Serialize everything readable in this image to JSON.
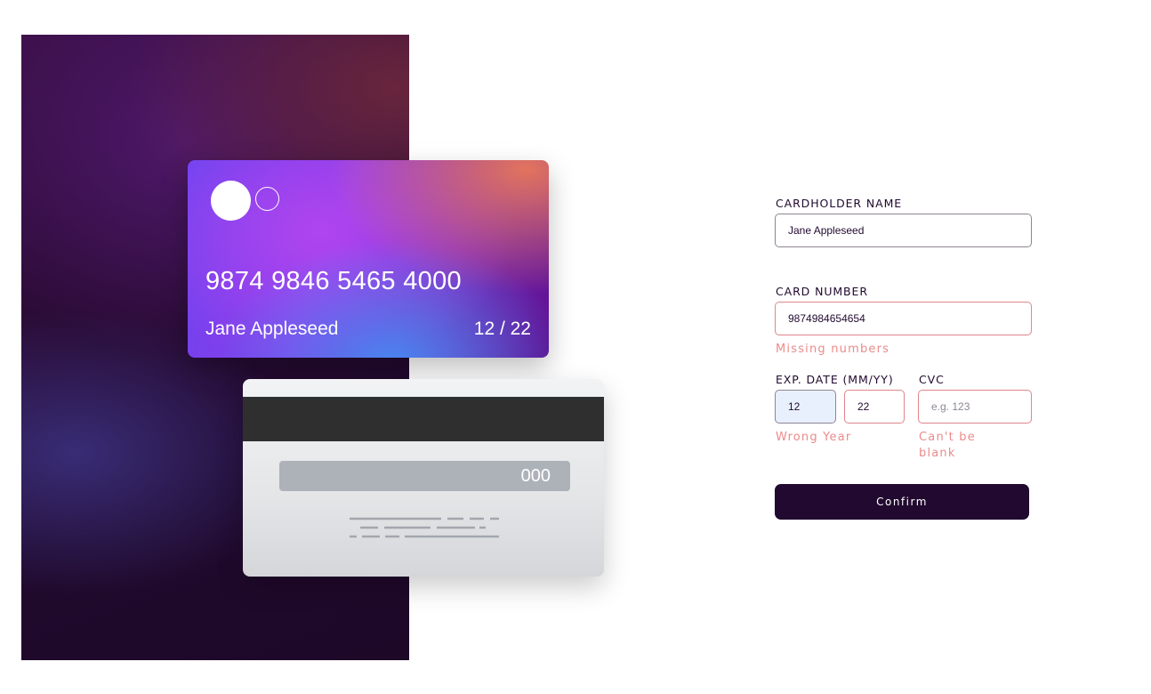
{
  "card_front": {
    "number": "9874 9846 5465 4000",
    "name": "Jane Appleseed",
    "expiry": "12 / 22"
  },
  "card_back": {
    "cvc": "000"
  },
  "form": {
    "cardholder_name": {
      "label": "CARDHOLDER NAME",
      "value": "Jane Appleseed"
    },
    "card_number": {
      "label": "CARD NUMBER",
      "value": "9874984654654",
      "error": "Missing numbers"
    },
    "exp_date": {
      "label": "EXP. DATE (MM/YY)",
      "month_value": "12",
      "year_value": "22",
      "error": "Wrong Year"
    },
    "cvc": {
      "label": "CVC",
      "placeholder": "e.g. 123",
      "value": "",
      "error_line1": "Can't be",
      "error_line2": "blank"
    },
    "confirm_label": "Confirm"
  },
  "colors": {
    "dark_violet": "#21092f",
    "error_red": "#ec8a8a",
    "input_border": "#8e8593"
  }
}
